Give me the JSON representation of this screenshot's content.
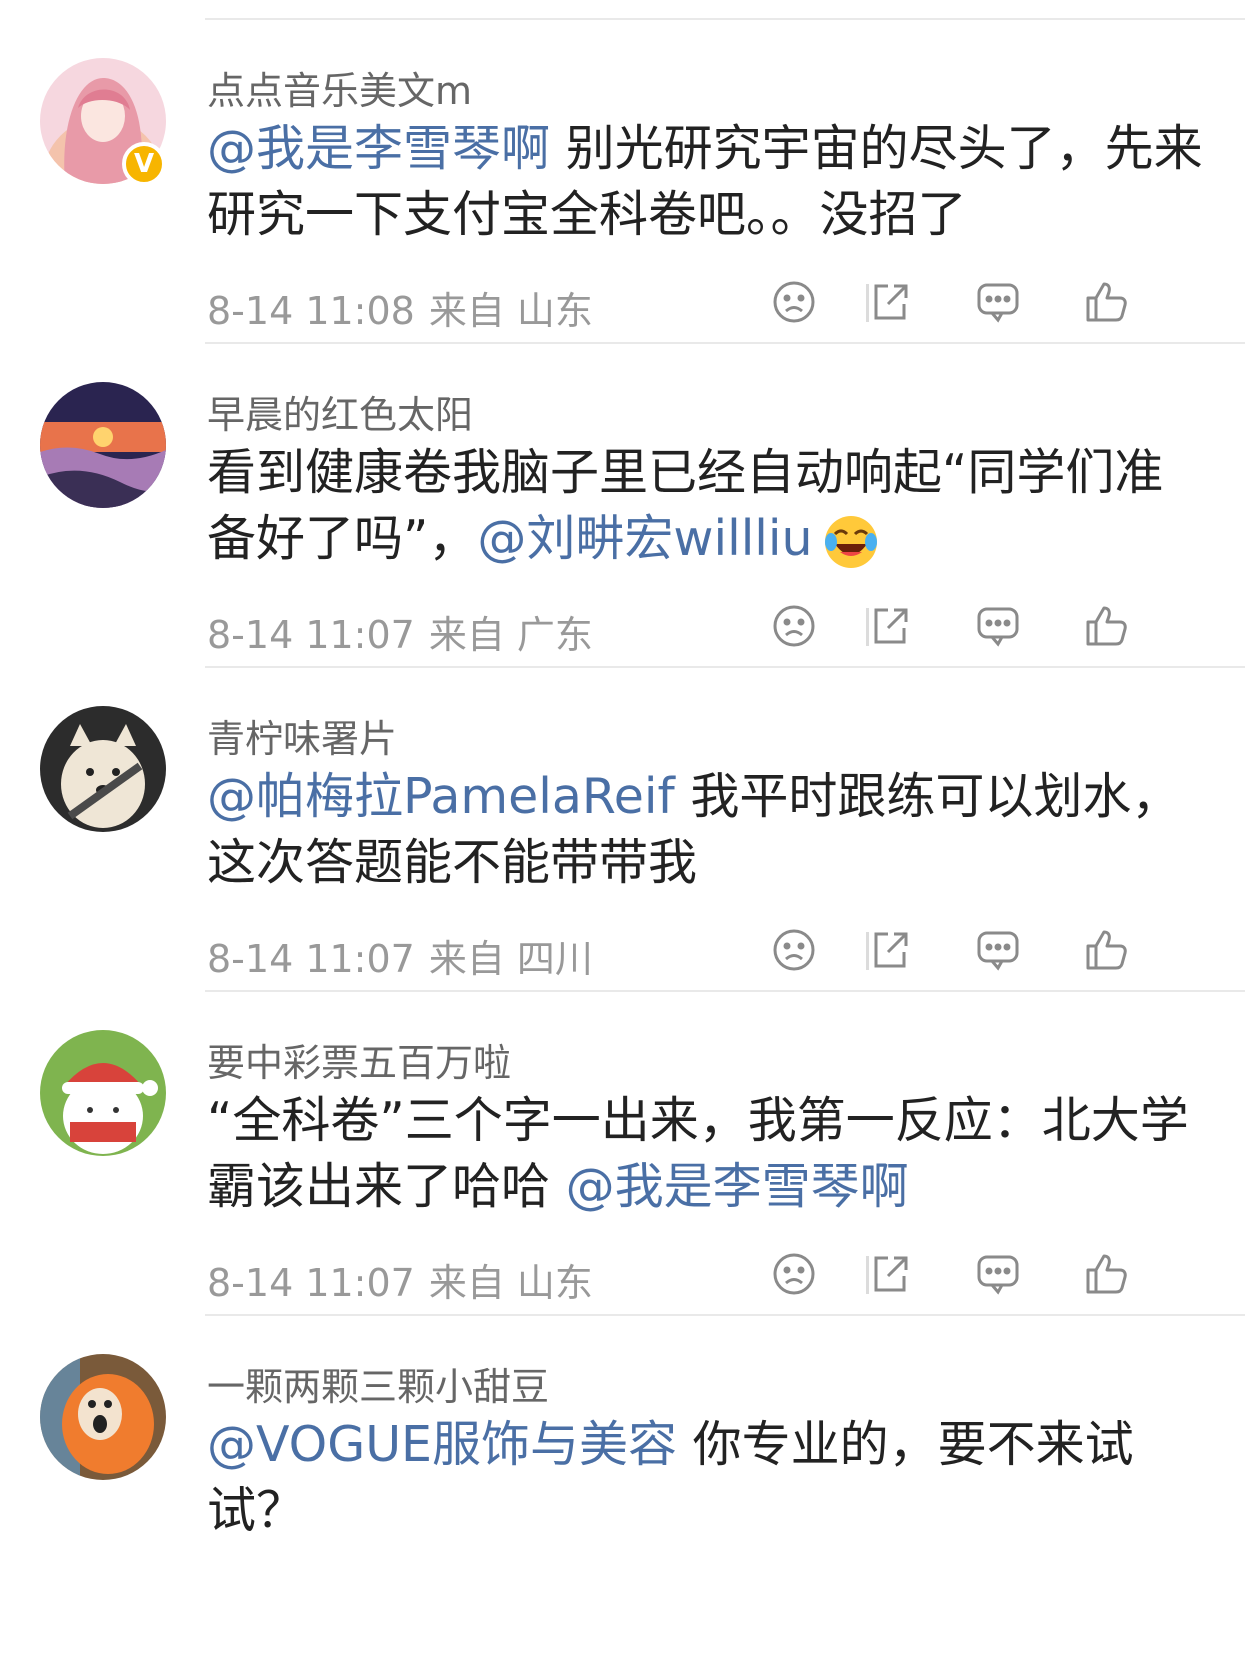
{
  "comments": [
    {
      "username": "点点音乐美文m",
      "verified_badge": "V",
      "mention": "@我是李雪琴啊",
      "text_before": "",
      "text_after": " 别光研究宇宙的尽头了，先来研究一下支付宝全科卷吧。。没招了",
      "time": "8-14 11:08",
      "location": "来自 山东",
      "avatar_colors": [
        "#f6d7df",
        "#e89aa8",
        "#f1b07a"
      ]
    },
    {
      "username": "早晨的红色太阳",
      "mention": "@刘畊宏willliu",
      "text_before": "看到健康卷我脑子里已经自动响起“同学们准备好了吗”，",
      "text_after": "",
      "emoji": "laughing-crying-emoji",
      "time": "8-14 11:07",
      "location": "来自 广东",
      "avatar_colors": [
        "#2a2450",
        "#e8734b",
        "#a77bb5"
      ]
    },
    {
      "username": "青柠味署片",
      "mention": "@帕梅拉PamelaReif",
      "text_before": "",
      "text_after": " 我平时跟练可以划水，这次答题能不能带带我",
      "time": "8-14 11:07",
      "location": "来自 四川",
      "avatar_colors": [
        "#2c2c2c",
        "#efe6d6",
        "#4a4a4a"
      ]
    },
    {
      "username": "要中彩票五百万啦",
      "mention": "@我是李雪琴啊",
      "text_before": "“全科卷”三个字一出来，我第一反应：北大学霸该出来了哈哈 ",
      "text_after": "",
      "time": "8-14 11:07",
      "location": "来自 山东",
      "avatar_colors": [
        "#7fb44f",
        "#d8433b",
        "#ffffff"
      ]
    },
    {
      "username": "一颗两颗三颗小甜豆",
      "mention": "@VOGUE服饰与美容",
      "text_before": "",
      "text_after": " 你专业的，要不来试试？",
      "time": "",
      "location": "",
      "avatar_colors": [
        "#7a5a3a",
        "#f07c2e",
        "#5aa0d8"
      ]
    }
  ],
  "action_icons": [
    "dislike-icon",
    "share-icon",
    "comment-icon",
    "like-icon"
  ],
  "colors": {
    "mention": "#4a6fa5",
    "meta": "#999999",
    "icon": "#8a8a8a"
  }
}
